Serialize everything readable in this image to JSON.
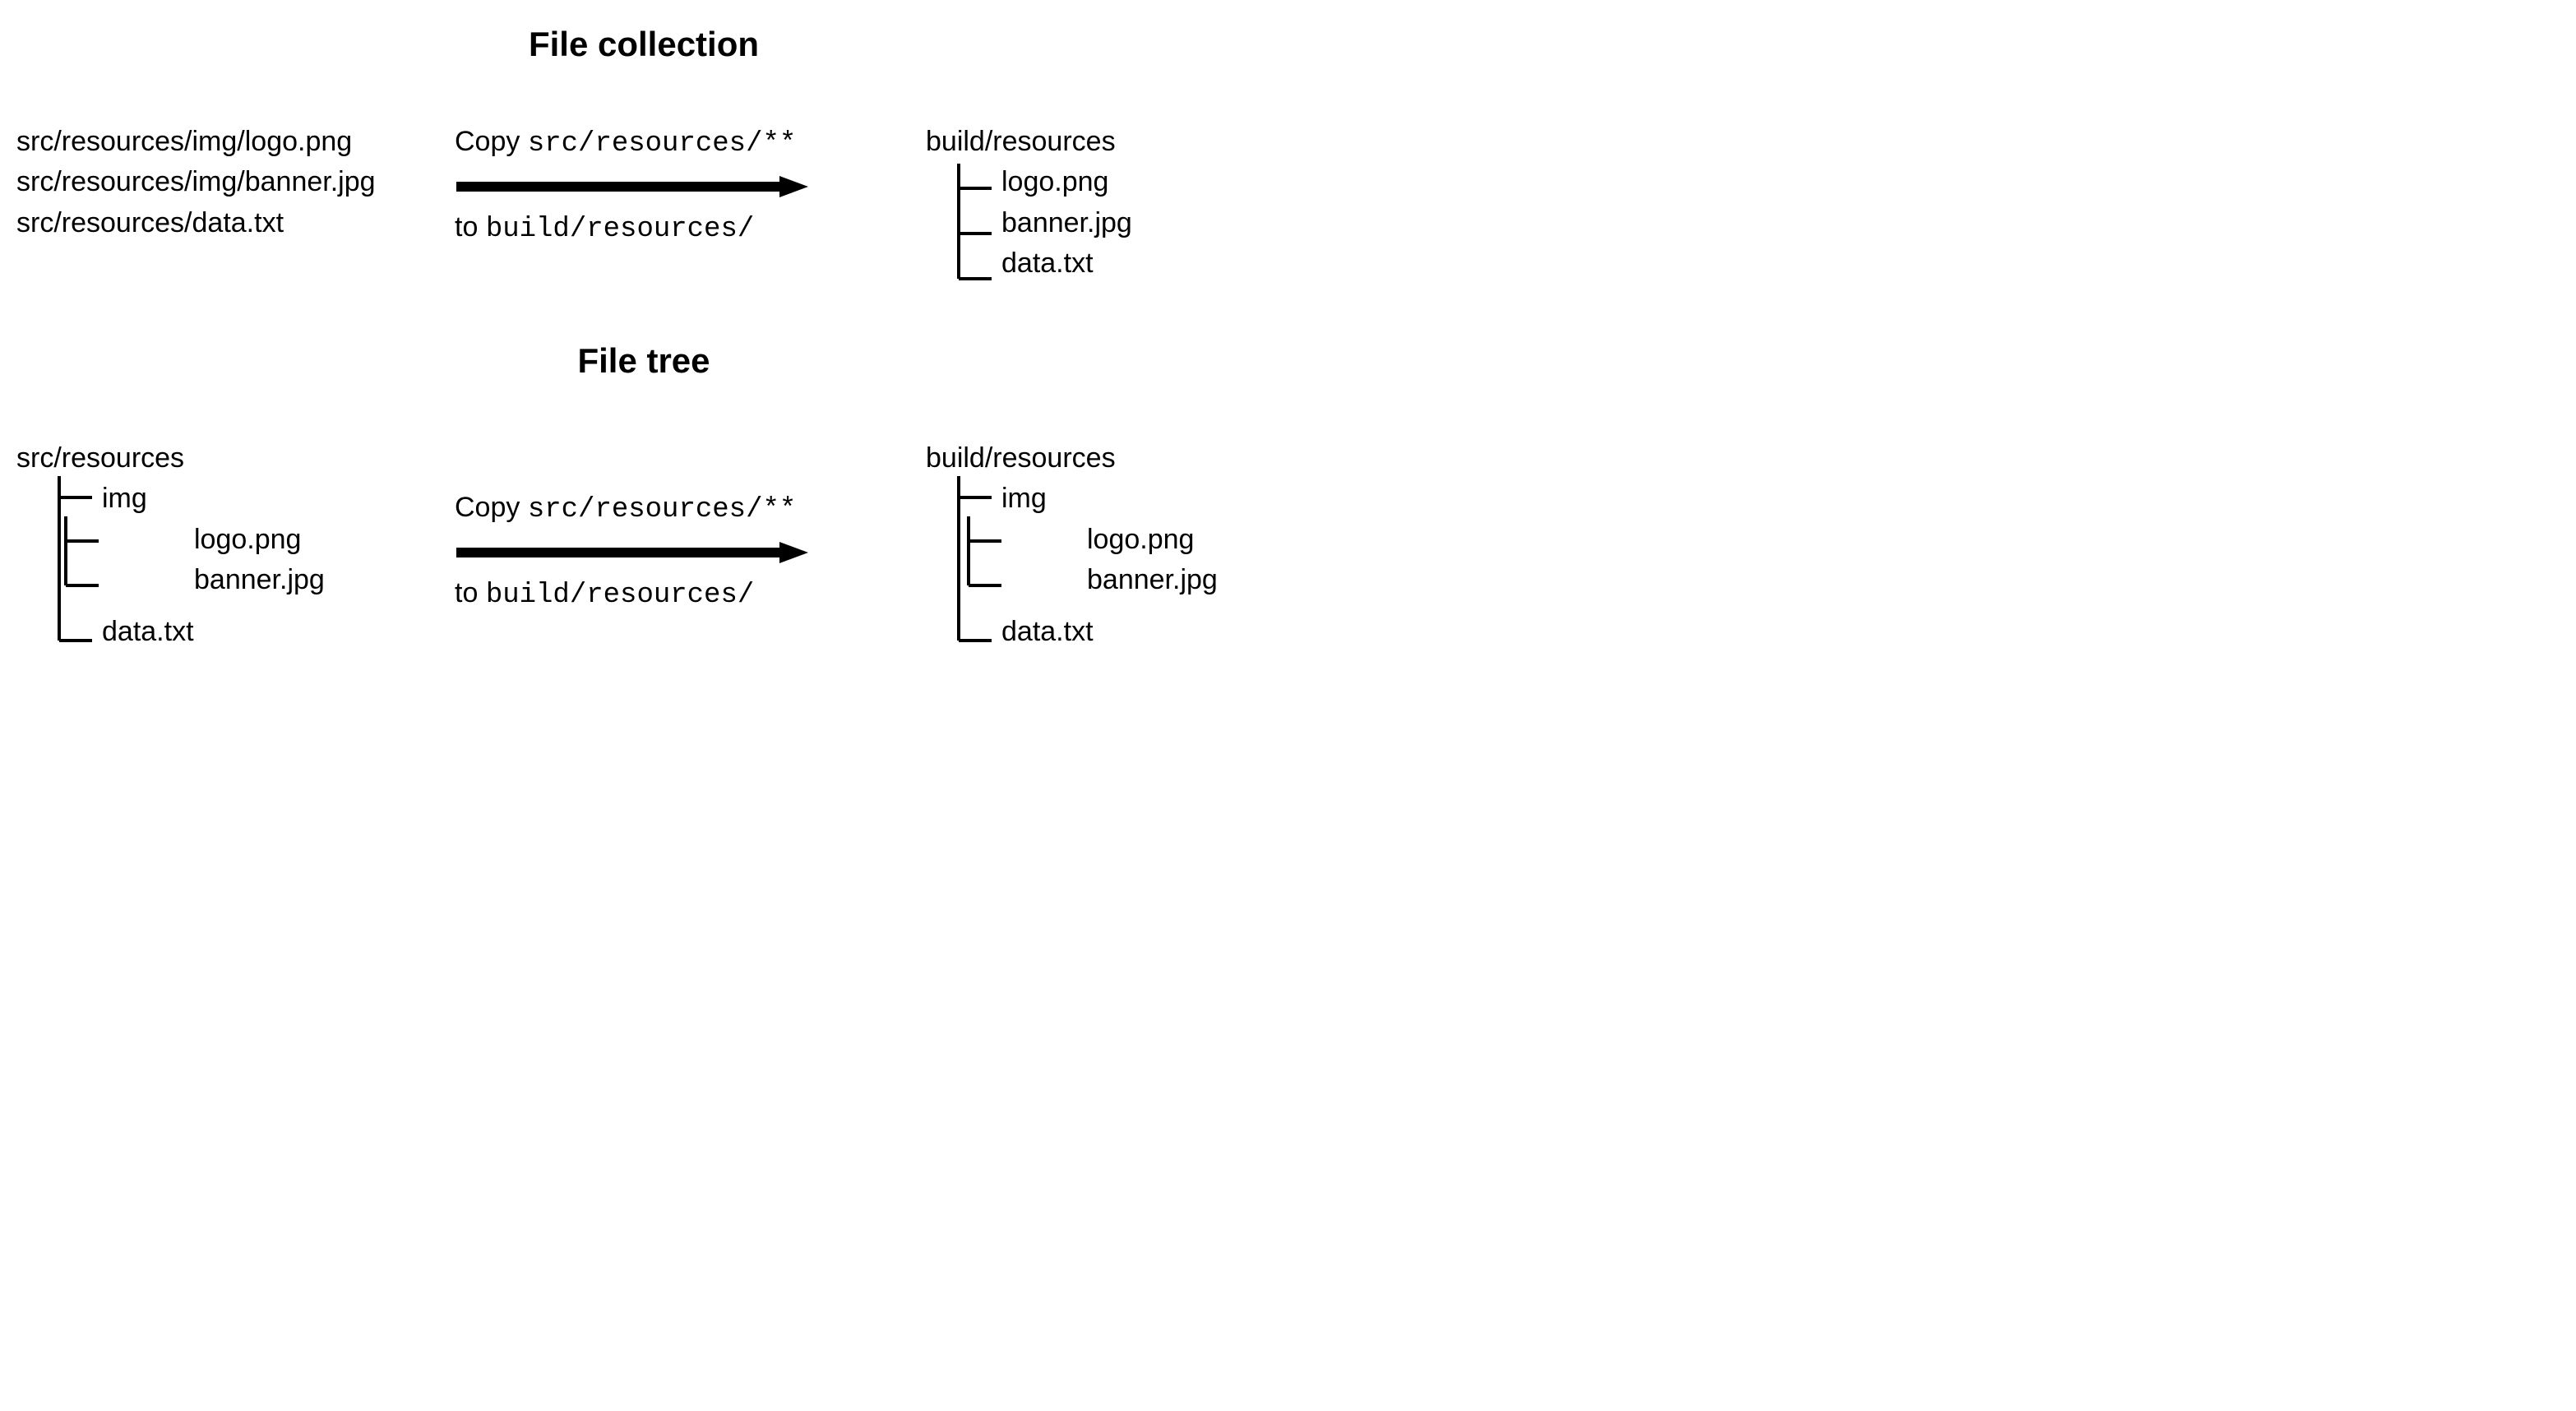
{
  "titles": {
    "file_collection": "File collection",
    "file_tree": "File tree"
  },
  "collection": {
    "source_paths": [
      "src/resources/img/logo.png",
      "src/resources/img/banner.jpg",
      "src/resources/data.txt"
    ],
    "copy_label_prefix": "Copy ",
    "copy_glob": "src/resources/**",
    "to_label_prefix": "to ",
    "to_path": "build/resources/",
    "dest_root": "build/resources",
    "dest_children": [
      "logo.png",
      "banner.jpg",
      "data.txt"
    ]
  },
  "tree": {
    "src_root": "src/resources",
    "src_tree": {
      "img": [
        "logo.png",
        "banner.jpg"
      ],
      "data": "data.txt"
    },
    "copy_label_prefix": "Copy ",
    "copy_glob": "src/resources/**",
    "to_label_prefix": "to ",
    "to_path": "build/resources/",
    "dest_root": "build/resources",
    "dest_tree": {
      "img": [
        "logo.png",
        "banner.jpg"
      ],
      "data": "data.txt"
    }
  }
}
